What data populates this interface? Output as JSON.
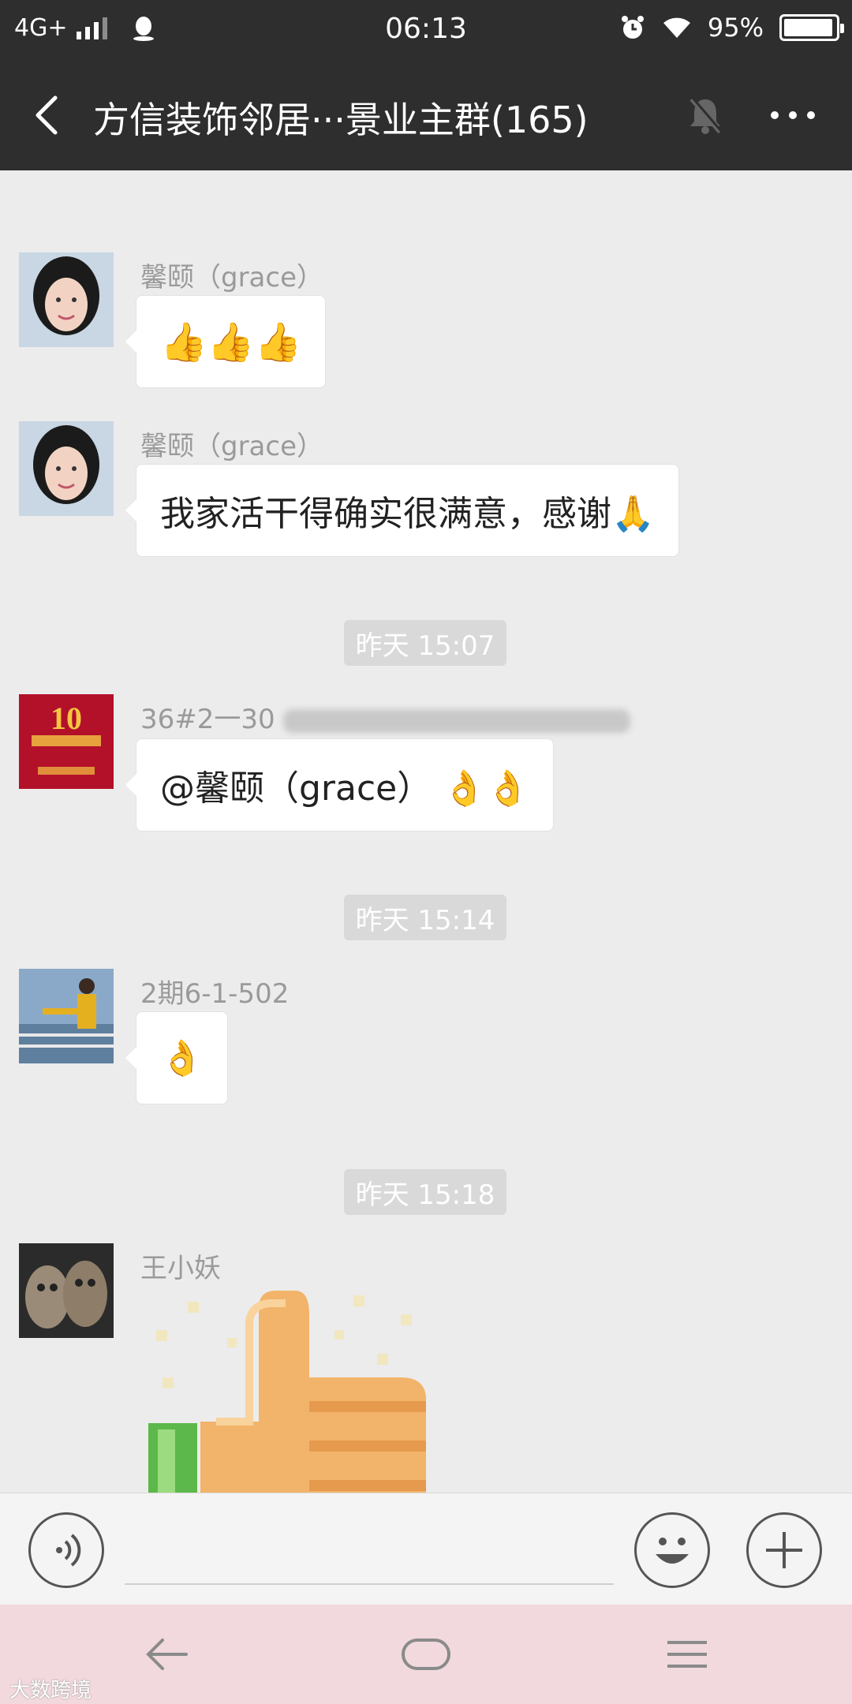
{
  "status_bar": {
    "network": "4G+",
    "time": "06:13",
    "battery_percent": "95%",
    "battery_level": 0.95
  },
  "header": {
    "title": "方信装饰邻居···景业主群(165)",
    "icons": [
      "back-arrow-icon",
      "mute-bell-icon",
      "more-icon"
    ]
  },
  "messages": [
    {
      "sender": "馨颐（grace）",
      "text": "👍👍👍"
    },
    {
      "sender": "馨颐（grace）",
      "text": "我家活干得确实很满意，感谢🙏"
    },
    {
      "timestamp": "昨天 15:07"
    },
    {
      "sender": "36#2一30",
      "text": "@馨颐（grace） 👌👌"
    },
    {
      "timestamp": "昨天 15:14"
    },
    {
      "sender": "2期6-1-502",
      "text": "👌"
    },
    {
      "timestamp": "昨天 15:18"
    },
    {
      "sender": "王小妖",
      "sticker": "thumbs-up-sticker"
    }
  ],
  "input_bar": {
    "value": "",
    "icons": [
      "voice-icon",
      "emoji-icon",
      "plus-icon"
    ]
  },
  "nav_bar": {
    "icons": [
      "back-nav-icon",
      "home-nav-icon",
      "menu-nav-icon"
    ]
  },
  "watermark": "大数跨境",
  "colors": {
    "header_bg": "#2e2e2e",
    "chat_bg": "#ececec",
    "bubble_bg": "#ffffff",
    "nav_bg": "#f1d9dd"
  }
}
